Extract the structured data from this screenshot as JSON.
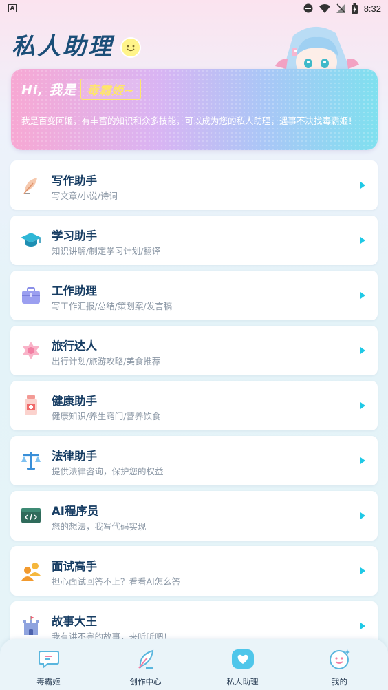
{
  "statusbar": {
    "time": "8:32"
  },
  "header": {
    "title": "私人助理"
  },
  "banner": {
    "greeting": "Hi, 我是",
    "name": "毒霸姬~",
    "description": "我是百变阿姬，有丰富的知识和众多技能，可以成为您的私人助理，遇事不决找毒霸姬！"
  },
  "assistants": [
    {
      "title": "写作助手",
      "subtitle": "写文章/小说/诗词",
      "icon": "feather-icon"
    },
    {
      "title": "学习助手",
      "subtitle": "知识讲解/制定学习计划/翻译",
      "icon": "graduation-cap-icon"
    },
    {
      "title": "工作助理",
      "subtitle": "写工作汇报/总结/策划案/发言稿",
      "icon": "briefcase-icon"
    },
    {
      "title": "旅行达人",
      "subtitle": "出行计划/旅游攻略/美食推荐",
      "icon": "star-flower-icon"
    },
    {
      "title": "健康助手",
      "subtitle": "健康知识/养生窍门/营养饮食",
      "icon": "medicine-bottle-icon"
    },
    {
      "title": "法律助手",
      "subtitle": "提供法律咨询，保护您的权益",
      "icon": "scales-icon"
    },
    {
      "title": "AI程序员",
      "subtitle": "您的想法，我写代码实现",
      "icon": "code-window-icon"
    },
    {
      "title": "面试高手",
      "subtitle": "担心面试回答不上？看看AI怎么答",
      "icon": "interview-people-icon"
    },
    {
      "title": "故事大王",
      "subtitle": "我有讲不完的故事，来听听吧！",
      "icon": "castle-icon"
    }
  ],
  "tabbar": {
    "tabs": [
      {
        "label": "毒霸姬",
        "icon": "chat-bubble-icon"
      },
      {
        "label": "创作中心",
        "icon": "pen-icon"
      },
      {
        "label": "私人助理",
        "icon": "assistant-heart-icon",
        "active": true
      },
      {
        "label": "我的",
        "icon": "smile-face-icon"
      }
    ]
  },
  "colors": {
    "accent": "#1fc9e6",
    "title": "#1b4e78",
    "active_tab": "#4fc6ea"
  }
}
